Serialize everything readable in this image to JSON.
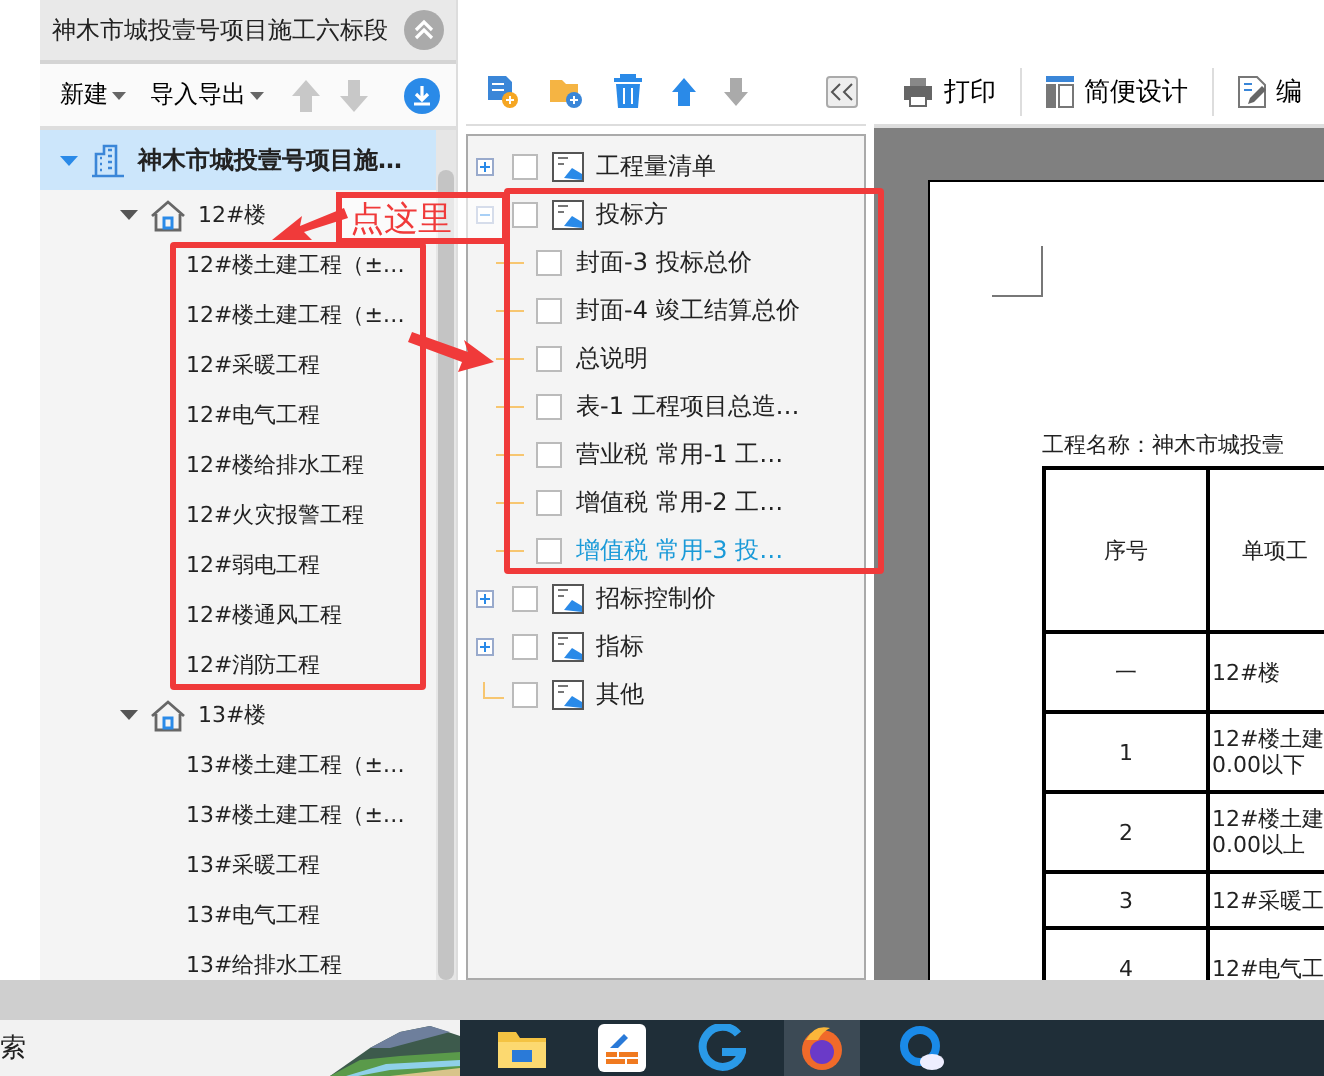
{
  "window": {
    "title": "神木市城投壹号项目施工六标段"
  },
  "left_toolbar": {
    "menus": [
      {
        "label": "新建"
      },
      {
        "label": "导入导出"
      }
    ]
  },
  "project_tree": {
    "root": {
      "label": "神木市城投壹号项目施…",
      "expanded": true,
      "selected": true,
      "children": [
        {
          "label": "12#楼",
          "expanded": true,
          "children": [
            {
              "label": "12#楼土建工程（±…"
            },
            {
              "label": "12#楼土建工程（±…"
            },
            {
              "label": "12#采暖工程"
            },
            {
              "label": "12#电气工程"
            },
            {
              "label": "12#楼给排水工程"
            },
            {
              "label": "12#火灾报警工程"
            },
            {
              "label": "12#弱电工程"
            },
            {
              "label": "12#楼通风工程"
            },
            {
              "label": "12#消防工程"
            }
          ]
        },
        {
          "label": "13#楼",
          "expanded": true,
          "children": [
            {
              "label": "13#楼土建工程（±…"
            },
            {
              "label": "13#楼土建工程（±…"
            },
            {
              "label": "13#采暖工程"
            },
            {
              "label": "13#电气工程"
            },
            {
              "label": "13#给排水工程"
            }
          ]
        }
      ]
    }
  },
  "report_tree": {
    "items": [
      {
        "label": "工程量清单",
        "checked": false,
        "expanded": false,
        "selected": false
      },
      {
        "label": "投标方",
        "checked": false,
        "expanded": true,
        "selected": false,
        "children": [
          {
            "label": "封面-3 投标总价",
            "checked": false,
            "selected": false
          },
          {
            "label": "封面-4 竣工结算总价",
            "checked": false,
            "selected": false
          },
          {
            "label": "总说明",
            "checked": false,
            "selected": false
          },
          {
            "label": "表-1 工程项目总造…",
            "checked": false,
            "selected": false
          },
          {
            "label": "营业税 常用-1 工…",
            "checked": false,
            "selected": false
          },
          {
            "label": "增值税 常用-2 工…",
            "checked": false,
            "selected": false
          },
          {
            "label": "增值税 常用-3 投…",
            "checked": false,
            "selected": true
          }
        ]
      },
      {
        "label": "招标控制价",
        "checked": false,
        "expanded": false,
        "selected": false
      },
      {
        "label": "指标",
        "checked": false,
        "expanded": false,
        "selected": false
      },
      {
        "label": "其他",
        "checked": false,
        "selected": false
      }
    ]
  },
  "preview_toolbar": [
    {
      "kind": "print",
      "label": "打印"
    },
    {
      "kind": "design",
      "label": "简便设计"
    },
    {
      "kind": "edit",
      "label": "编"
    }
  ],
  "document": {
    "project_line": "工程名称：神木市城投壹",
    "columns": [
      "序号",
      "单项工"
    ],
    "rows": [
      [
        [
          "一"
        ],
        [
          "12#楼"
        ]
      ],
      [
        [
          "1"
        ],
        [
          "12#楼土建",
          "0.00以下"
        ]
      ],
      [
        [
          "2"
        ],
        [
          "12#楼土建",
          "0.00以上"
        ]
      ],
      [
        [
          "3"
        ],
        [
          "12#采暖工"
        ]
      ],
      [
        [
          "4"
        ],
        [
          "12#电气工"
        ]
      ]
    ]
  },
  "annotation": {
    "callout": "点这里"
  },
  "taskbar": {
    "search_fragment": "索",
    "apps": [
      {
        "kind": "folder",
        "selected": false
      },
      {
        "kind": "tile",
        "selected": false
      },
      {
        "kind": "spiral",
        "selected": false
      },
      {
        "kind": "fox",
        "selected": true
      },
      {
        "kind": "ring",
        "selected": false
      }
    ]
  }
}
